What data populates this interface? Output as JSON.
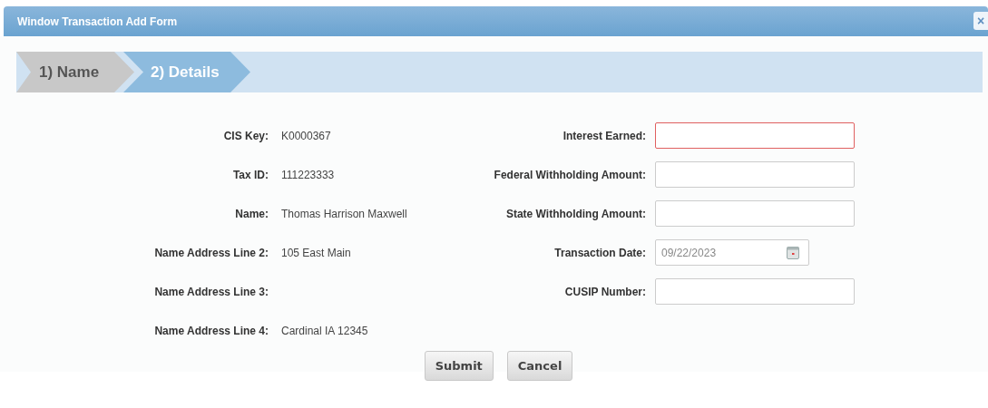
{
  "window": {
    "title": "Window Transaction Add Form",
    "close": "×"
  },
  "steps": [
    {
      "label": "1) Name",
      "selected": false
    },
    {
      "label": "2) Details",
      "selected": true
    }
  ],
  "info": [
    {
      "label": "CIS Key:",
      "value": "K0000367"
    },
    {
      "label": "Tax ID:",
      "value": "111223333"
    },
    {
      "label": "Name:",
      "value": "Thomas Harrison Maxwell"
    },
    {
      "label": "Name Address Line 2:",
      "value": "105 East Main"
    },
    {
      "label": "Name Address Line 3:"
    },
    {
      "label": "Name Address Line 4:",
      "value": "Cardinal IA 12345"
    }
  ],
  "fields": [
    {
      "label": "Interest Earned:",
      "kind": "text",
      "error": true
    },
    {
      "label": "Federal Withholding Amount:",
      "kind": "text",
      "error": false
    },
    {
      "label": "State Withholding Amount:",
      "kind": "text",
      "error": false
    },
    {
      "label": "Transaction Date:",
      "kind": "date",
      "error": false,
      "value": "09/22/2023"
    },
    {
      "label": "CUSIP Number:",
      "kind": "text",
      "error": false
    }
  ],
  "buttons": [
    "Submit",
    "Cancel"
  ]
}
